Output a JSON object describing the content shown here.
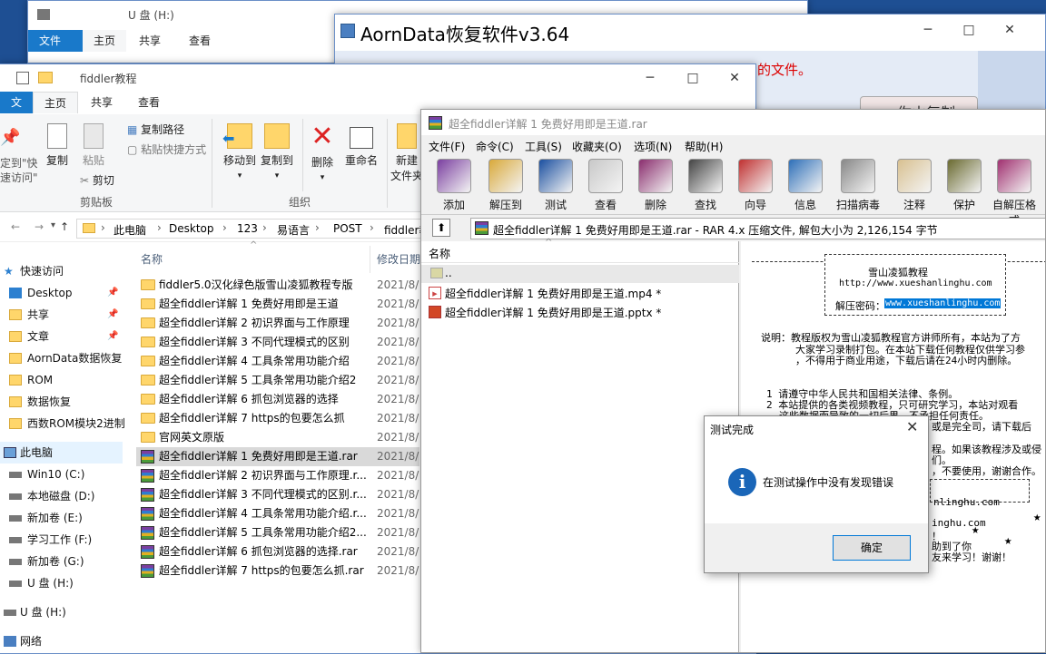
{
  "win_back": {
    "title": "U 盘 (H:)",
    "tabs": [
      "文件",
      "主页",
      "共享",
      "查看"
    ],
    "ghost_label": "复制路径"
  },
  "aorn": {
    "title": "AornData恢复软件v3.64",
    "red_text": "的文件。",
    "cut_button": "你山复制"
  },
  "explorer": {
    "title": "fiddler教程",
    "tabs": [
      "文件",
      "主页",
      "共享",
      "查看"
    ],
    "ribbon": {
      "pin_label_1": "定到\"快",
      "pin_label_2": "速访问\"",
      "copy": "复制",
      "paste": "粘贴",
      "copy_path": "复制路径",
      "paste_shortcut": "粘贴快捷方式",
      "cut": "剪切",
      "clipboard_group": "剪贴板",
      "move_to": "移动到",
      "copy_to": "复制到",
      "delete": "删除",
      "rename": "重命名",
      "organize_group": "组织",
      "new_folder_1": "新建",
      "new_folder_2": "文件夹"
    },
    "breadcrumb": [
      "此电脑",
      "Desktop",
      "123",
      "易语言",
      "POST",
      "fiddler教"
    ],
    "columns": {
      "name": "名称",
      "date": "修改日期"
    },
    "nav": [
      {
        "label": "快速访问",
        "type": "star"
      },
      {
        "label": "Desktop",
        "type": "blue",
        "pinned": true
      },
      {
        "label": "共享",
        "type": "folder",
        "pinned": true
      },
      {
        "label": "文章",
        "type": "folder",
        "pinned": true
      },
      {
        "label": "AornData数据恢复",
        "type": "folder"
      },
      {
        "label": "ROM",
        "type": "folder"
      },
      {
        "label": "数据恢复",
        "type": "folder"
      },
      {
        "label": "西数ROM模块2进制",
        "type": "folder"
      },
      {
        "label": "此电脑",
        "type": "pc"
      },
      {
        "label": "Win10 (C:)",
        "type": "drive"
      },
      {
        "label": "本地磁盘 (D:)",
        "type": "drive"
      },
      {
        "label": "新加卷 (E:)",
        "type": "drive"
      },
      {
        "label": "学习工作 (F:)",
        "type": "drive"
      },
      {
        "label": "新加卷 (G:)",
        "type": "drive"
      },
      {
        "label": "U 盘 (H:)",
        "type": "drive"
      },
      {
        "label": "U 盘 (H:)",
        "type": "drive"
      },
      {
        "label": "网络",
        "type": "net"
      }
    ],
    "files": [
      {
        "name": "fiddler5.0汉化绿色版雪山凌狐教程专版",
        "date": "2021/8/",
        "type": "folder"
      },
      {
        "name": "超全fiddler详解 1 免费好用即是王道",
        "date": "2021/8/",
        "type": "folder"
      },
      {
        "name": "超全fiddler详解 2 初识界面与工作原理",
        "date": "2021/8/",
        "type": "folder"
      },
      {
        "name": "超全fiddler详解 3 不同代理模式的区别",
        "date": "2021/8/",
        "type": "folder"
      },
      {
        "name": "超全fiddler详解 4 工具条常用功能介绍",
        "date": "2021/8/",
        "type": "folder"
      },
      {
        "name": "超全fiddler详解 5 工具条常用功能介绍2",
        "date": "2021/8/",
        "type": "folder"
      },
      {
        "name": "超全fiddler详解 6 抓包浏览器的选择",
        "date": "2021/8/",
        "type": "folder"
      },
      {
        "name": "超全fiddler详解 7 https的包要怎么抓",
        "date": "2021/8/",
        "type": "folder"
      },
      {
        "name": "官网英文原版",
        "date": "2021/8/",
        "type": "folder"
      },
      {
        "name": "超全fiddler详解 1 免费好用即是王道.rar",
        "date": "2021/8/",
        "type": "rar",
        "selected": true
      },
      {
        "name": "超全fiddler详解 2 初识界面与工作原理.r...",
        "date": "2021/8/",
        "type": "rar"
      },
      {
        "name": "超全fiddler详解 3 不同代理模式的区别.r...",
        "date": "2021/8/",
        "type": "rar"
      },
      {
        "name": "超全fiddler详解 4 工具条常用功能介绍.r...",
        "date": "2021/8/",
        "type": "rar"
      },
      {
        "name": "超全fiddler详解 5 工具条常用功能介绍2...",
        "date": "2021/8/",
        "type": "rar"
      },
      {
        "name": "超全fiddler详解 6 抓包浏览器的选择.rar",
        "date": "2021/8/",
        "type": "rar"
      },
      {
        "name": "超全fiddler详解 7 https的包要怎么抓.rar",
        "date": "2021/8/",
        "type": "rar"
      }
    ]
  },
  "winrar": {
    "title": "超全fiddler详解 1 免费好用即是王道.rar",
    "menu": [
      "文件(F)",
      "命令(C)",
      "工具(S)",
      "收藏夹(O)",
      "选项(N)",
      "帮助(H)"
    ],
    "tools": [
      "添加",
      "解压到",
      "测试",
      "查看",
      "删除",
      "查找",
      "向导",
      "信息",
      "扫描病毒",
      "注释",
      "保护",
      "自解压格式"
    ],
    "path": "超全fiddler详解 1 免费好用即是王道.rar - RAR 4.x 压缩文件, 解包大小为 2,126,154 字节",
    "col_name": "名称",
    "items": [
      "..",
      "超全fiddler详解 1 免费好用即是王道.mp4 *",
      "超全fiddler详解 1 免费好用即是王道.pptx *"
    ],
    "comment": {
      "head_title": "雪山凌狐教程",
      "head_url": "http://www.xueshanlinghu.com",
      "pwd_label": "解压密码：",
      "pwd_value": "www.xueshanlinghu.com",
      "line1": "说明：教程版权为雪山凌狐教程官方讲师所有，本站为了方",
      "line2": "大家学习录制打包。在本站下载任何教程仅供学习参",
      "line3": "，不得用于商业用途，下载后请在24小时内删除。",
      "line4": "1 请遵守中华人民共和国相关法律、条例。",
      "line5": "2 本站提供的各类视频教程，只可研究学习，本站对观看",
      "line6": "这些数据而导致的一切后果，不承担任何责任。",
      "line7": "或是完全司，请下载后",
      "line8": "程。如果该教程涉及或侵",
      "line9": "们。",
      "line10": "，不要使用，谢谢合作。",
      "line11": "nlinghu.com",
      "line12": "inghu.com",
      "line13": "！",
      "line14": "助到了你",
      "line15": "友来学习！谢谢！"
    }
  },
  "dialog": {
    "title": "测试完成",
    "message": "在测试操作中没有发现错误",
    "ok": "确定"
  },
  "colors": {
    "accent": "#1979ca",
    "selection": "#cce8ff",
    "desktop": "#1e4f93"
  }
}
